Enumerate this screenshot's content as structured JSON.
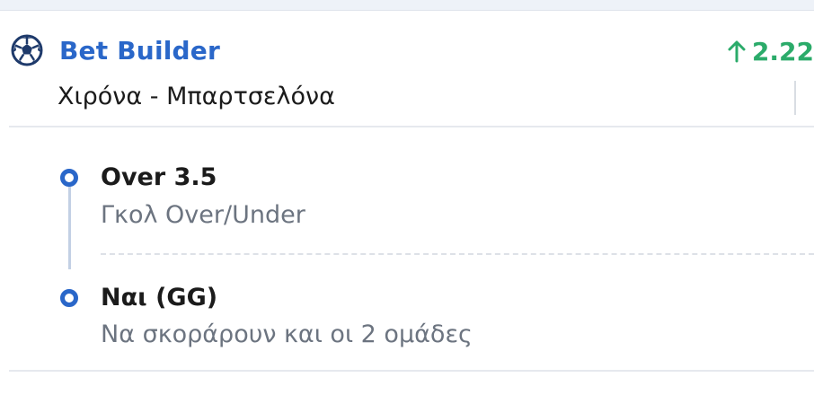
{
  "bet": {
    "title": "Bet Builder",
    "odds": "2.22",
    "odds_trend": "up",
    "match": "Χιρόνα - Μπαρτσελόνα"
  },
  "selections": [
    {
      "pick": "Over 3.5",
      "market": "Γκολ Over/Under"
    },
    {
      "pick": "Ναι (GG)",
      "market": "Να σκοράρουν και οι 2 ομάδες"
    }
  ],
  "colors": {
    "brand_blue": "#2a67c9",
    "odds_up_green": "#2bab6a",
    "muted_text": "#6c7480"
  },
  "icons": {
    "sport": "soccer-ball-icon",
    "trend": "arrow-up-icon"
  }
}
